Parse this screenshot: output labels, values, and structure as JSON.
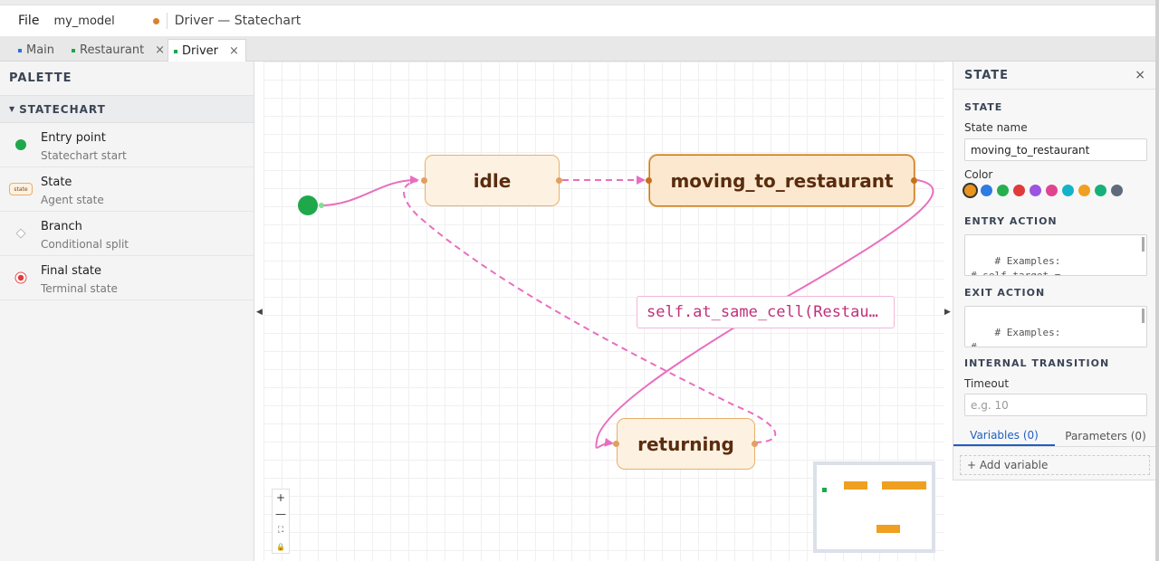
{
  "menubar": {
    "file": "File",
    "model_name": "my_model",
    "doc_title": "Driver — Statechart"
  },
  "tabs": [
    {
      "label": "Main",
      "color": "#2f6fd6",
      "closable": false
    },
    {
      "label": "Restaurant",
      "color": "#22a34a",
      "closable": true
    },
    {
      "label": "Driver",
      "color": "#22a34a",
      "closable": true,
      "active": true
    }
  ],
  "tab_close_glyph": "×",
  "palette": {
    "title": "PALETTE",
    "section": "STATECHART",
    "items": [
      {
        "name": "Entry point",
        "desc": "Statechart start",
        "icon": "entry-point-icon"
      },
      {
        "name": "State",
        "desc": "Agent state",
        "icon": "state-icon",
        "icon_text": "state"
      },
      {
        "name": "Branch",
        "desc": "Conditional split",
        "icon": "branch-icon"
      },
      {
        "name": "Final state",
        "desc": "Terminal state",
        "icon": "final-state-icon"
      }
    ]
  },
  "canvas": {
    "states": [
      {
        "id": "idle",
        "label": "idle"
      },
      {
        "id": "moving",
        "label": "moving_to_restaurant",
        "selected": true
      },
      {
        "id": "returning",
        "label": "returning"
      }
    ],
    "guard_label": "self.at_same_cell(Restau…",
    "zoom_controls": [
      "+",
      "—",
      "⛶",
      "🔒"
    ],
    "transition_color": "#e86fbf"
  },
  "properties": {
    "title": "STATE",
    "close": "×",
    "state_section": "STATE",
    "state_name_label": "State name",
    "state_name_value": "moving_to_restaurant",
    "color_label": "Color",
    "colors": [
      "#e8941f",
      "#2f7be0",
      "#25b04d",
      "#e03a3a",
      "#9b55e0",
      "#e0448f",
      "#15b3c9",
      "#f0a020",
      "#18b07a",
      "#5f6b7c"
    ],
    "selected_color": "#e8941f",
    "entry_action_label": "ENTRY ACTION",
    "entry_action_code": "# Examples:\n# self.target =\nself.nearest(Restaurant)",
    "exit_action_label": "EXIT ACTION",
    "exit_action_code": "# Examples:\n#\nself.model.variables['active",
    "internal_transition_label": "INTERNAL TRANSITION",
    "timeout_label": "Timeout",
    "timeout_placeholder": "e.g. 10",
    "tab_variables": "Variables (0)",
    "tab_parameters": "Parameters (0)",
    "add_variable": "+ Add variable"
  }
}
